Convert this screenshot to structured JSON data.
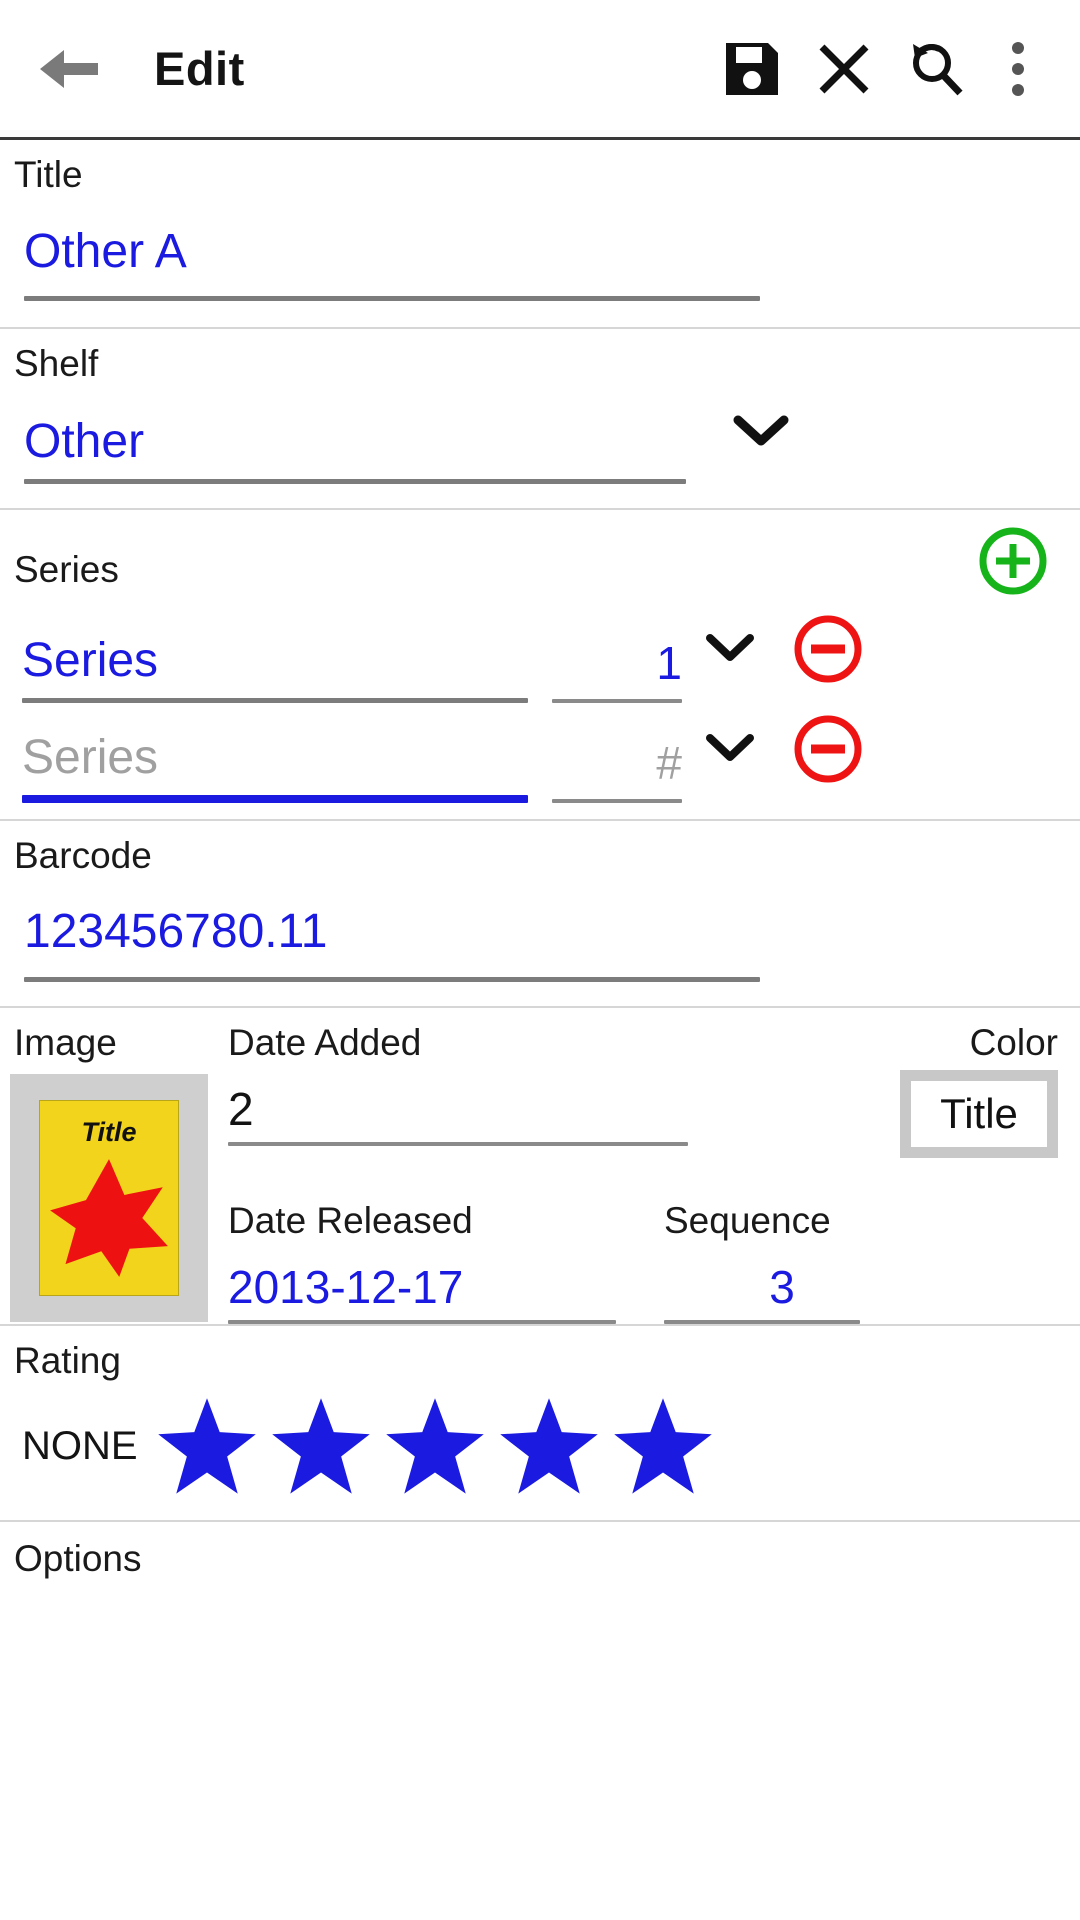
{
  "appbar": {
    "back_icon": "arrow-left-icon",
    "title": "Edit",
    "actions": [
      {
        "icon": "save-floppy-icon",
        "name": "save-button"
      },
      {
        "icon": "close-x-icon",
        "name": "cancel-button"
      },
      {
        "icon": "search-refresh-icon",
        "name": "search-refresh-button"
      },
      {
        "icon": "overflow-menu-icon",
        "name": "overflow-menu-button"
      }
    ]
  },
  "fields": {
    "title": {
      "label": "Title",
      "value": "Other A"
    },
    "shelf": {
      "label": "Shelf",
      "value": "Other",
      "chevron": "chevron-down-icon"
    },
    "series": {
      "label": "Series",
      "add_icon": "plus-circle-icon",
      "rows": [
        {
          "name_value": "Series",
          "name_placeholder": "Series",
          "num_value": "1",
          "num_placeholder": "#",
          "filled": true,
          "focused": false,
          "chevron": "chevron-down-icon",
          "remove_icon": "minus-circle-icon"
        },
        {
          "name_value": "",
          "name_placeholder": "Series",
          "num_value": "",
          "num_placeholder": "#",
          "filled": false,
          "focused": true,
          "chevron": "chevron-down-icon",
          "remove_icon": "minus-circle-icon"
        }
      ]
    },
    "barcode": {
      "label": "Barcode",
      "value": "123456780.11"
    },
    "image": {
      "label": "Image",
      "cover_title": "Title",
      "cover_bg": "#f2d41c",
      "cover_star": "#ee1111",
      "frame_bg": "#cfcfcf"
    },
    "date_added": {
      "label": "Date Added",
      "value": "2"
    },
    "color": {
      "label": "Color",
      "value": "Title",
      "swatch_bg": "#c8c8c8",
      "swatch_inner": "#ffffff"
    },
    "date_released": {
      "label": "Date Released",
      "value": "2013-12-17"
    },
    "sequence": {
      "label": "Sequence",
      "value": "3"
    },
    "rating": {
      "label": "Rating",
      "value_text": "NONE",
      "star_color": "#1a1ae0",
      "stars": 5
    },
    "options": {
      "label": "Options"
    }
  },
  "colors": {
    "accent_blue": "#1a1ae0",
    "label_black": "#1a1a1a",
    "placeholder_gray": "#a0a0a0",
    "underline_gray": "#7c7c7c",
    "add_green": "#16b41a",
    "remove_red": "#ee1414",
    "divider": "#d6d6d6"
  }
}
